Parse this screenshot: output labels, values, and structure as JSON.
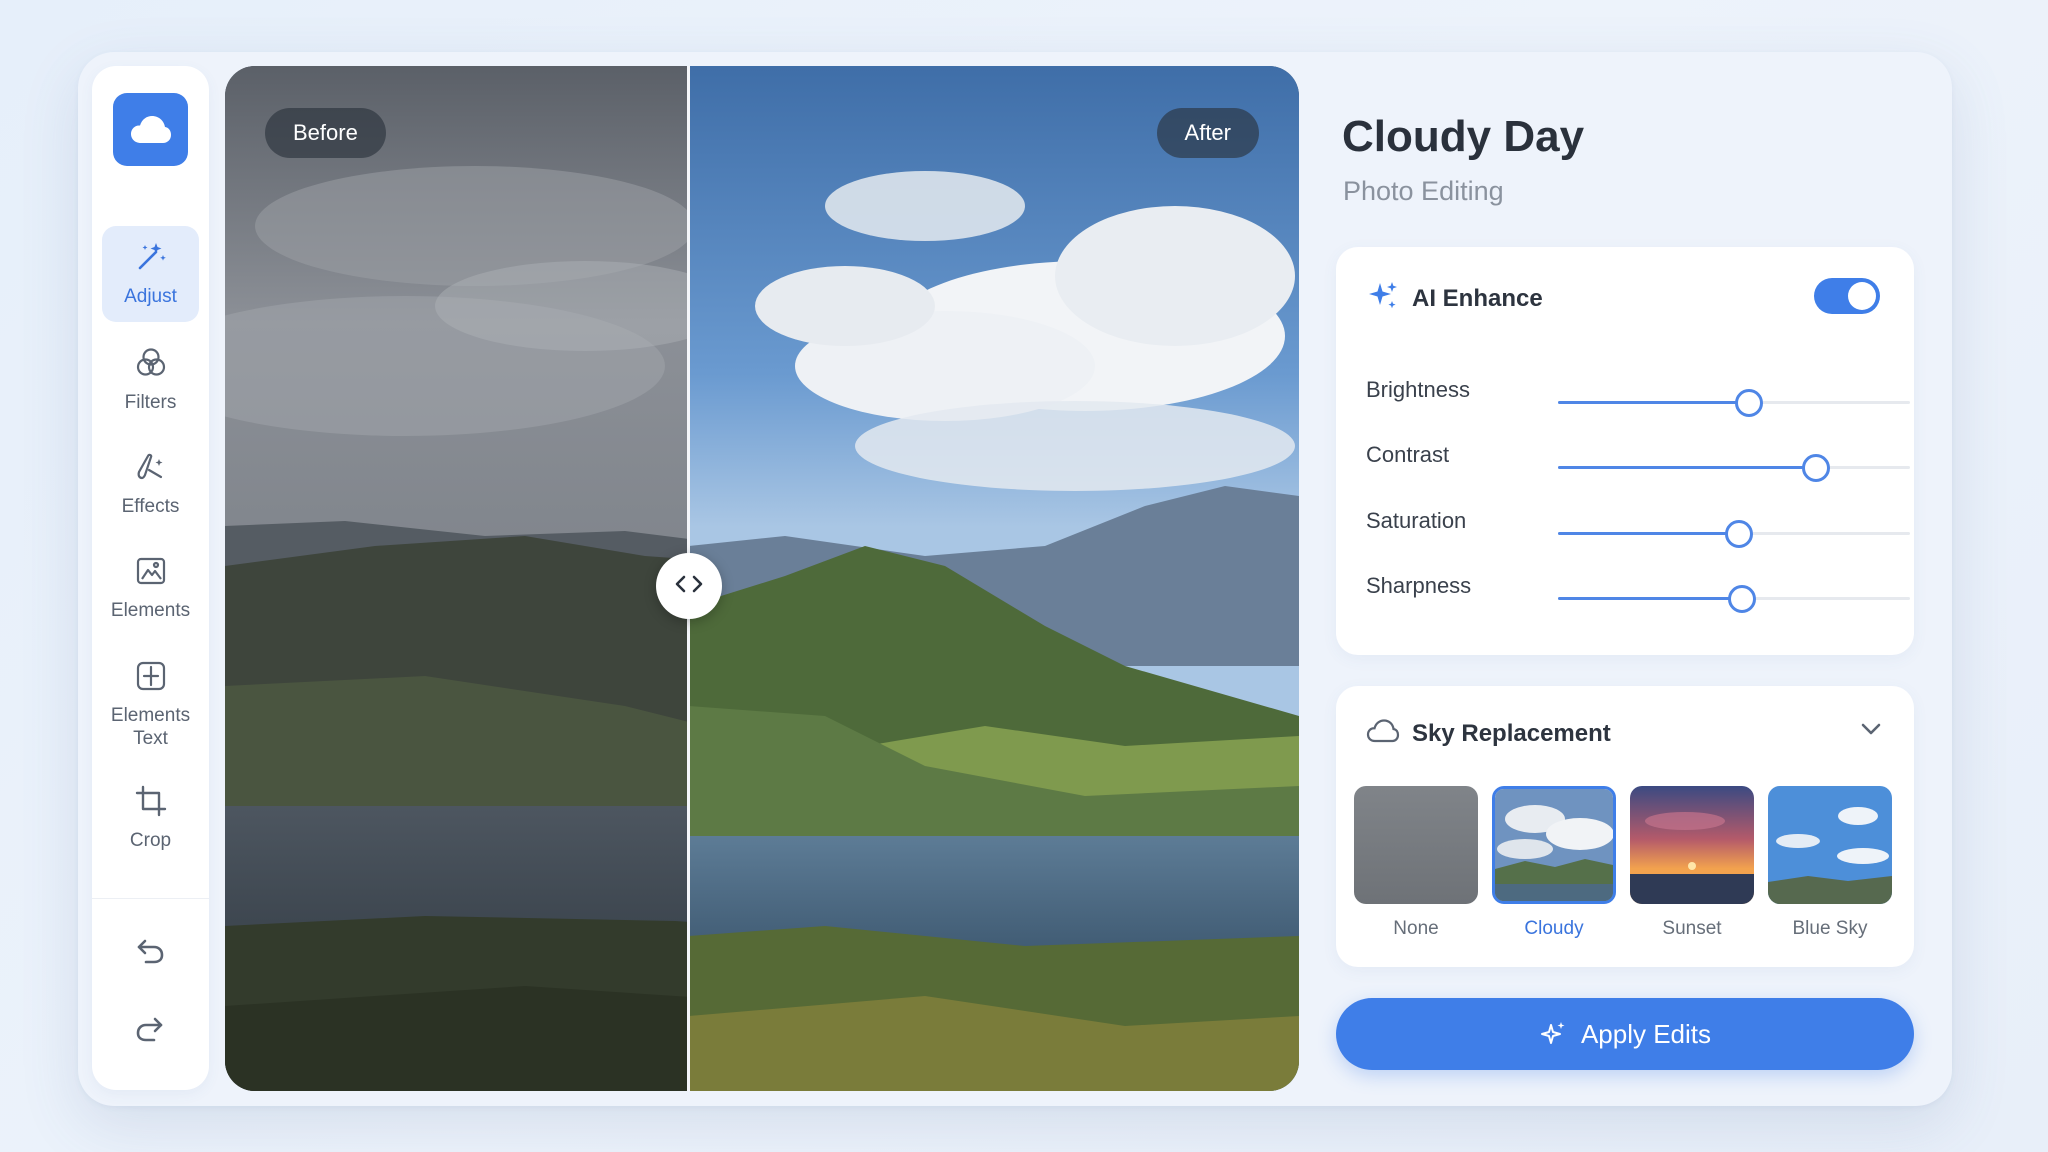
{
  "sidebar": {
    "logo_icon": "cloud-icon",
    "tools": [
      {
        "label": "Adjust",
        "icon": "magic-wand-icon",
        "active": true
      },
      {
        "label": "Filters",
        "icon": "filters-icon",
        "active": false
      },
      {
        "label": "Effects",
        "icon": "brush-sparkle-icon",
        "active": false
      },
      {
        "label": "Elements",
        "icon": "image-frame-icon",
        "active": false
      },
      {
        "label": "Elements",
        "label2": "Text",
        "icon": "text-box-icon",
        "active": false
      },
      {
        "label": "Crop",
        "icon": "crop-icon",
        "active": false
      }
    ],
    "undo_icon": "undo-icon",
    "redo_icon": "redo-icon"
  },
  "canvas": {
    "before_label": "Before",
    "after_label": "After",
    "split_icon": "chevron-left-right-icon"
  },
  "panel": {
    "title": "Cloudy Day",
    "subtitle": "Photo Editing",
    "enhance": {
      "label": "AI Enhance",
      "icon": "sparkle-icon",
      "enabled": true,
      "sliders": [
        {
          "name": "Brightness",
          "value": 0.54
        },
        {
          "name": "Contrast",
          "value": 0.73
        },
        {
          "name": "Saturation",
          "value": 0.51
        },
        {
          "name": "Sharpness",
          "value": 0.52
        }
      ]
    },
    "sky": {
      "label": "Sky Replacement",
      "icon": "cloud-outline-icon",
      "options": [
        {
          "label": "None",
          "selected": false
        },
        {
          "label": "Cloudy",
          "selected": true
        },
        {
          "label": "Sunset",
          "selected": false
        },
        {
          "label": "Blue Sky",
          "selected": false
        }
      ]
    },
    "apply_label": "Apply Edits"
  },
  "colors": {
    "accent": "#3f7ee8",
    "background": "#eef3fb"
  }
}
